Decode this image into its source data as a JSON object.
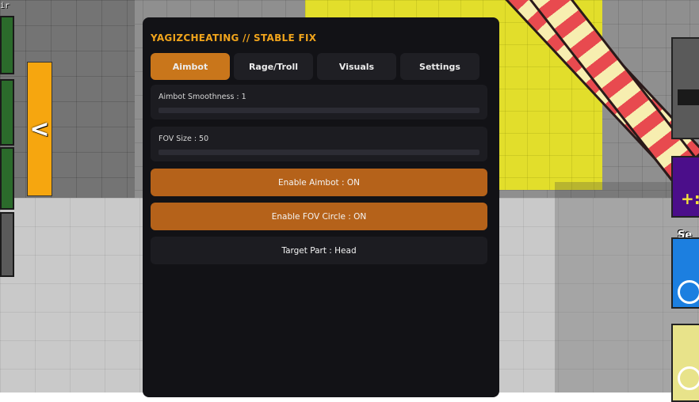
{
  "hud": {
    "corner_label": "ir",
    "tab_arrow": "<",
    "right_label": "Se",
    "purple_badge": "+:"
  },
  "panel": {
    "title": "YAGIZCHEATING // STABLE FIX",
    "tabs": [
      {
        "label": "Aimbot",
        "active": true
      },
      {
        "label": "Rage/Troll",
        "active": false
      },
      {
        "label": "Visuals",
        "active": false
      },
      {
        "label": "Settings",
        "active": false
      }
    ],
    "sliders": [
      {
        "label": "Aimbot Smoothness : 1",
        "value": 1
      },
      {
        "label": "FOV Size : 50",
        "value": 50
      }
    ],
    "buttons": [
      {
        "label": "Enable Aimbot : ON",
        "state": "on"
      },
      {
        "label": "Enable FOV Circle : ON",
        "state": "on"
      },
      {
        "label": "Target Part : Head",
        "state": "neutral"
      }
    ]
  },
  "colors": {
    "accent": "#c9761b",
    "button_on": "#b5621a",
    "panel_bg": "#121216",
    "title": "#f0a41c"
  }
}
